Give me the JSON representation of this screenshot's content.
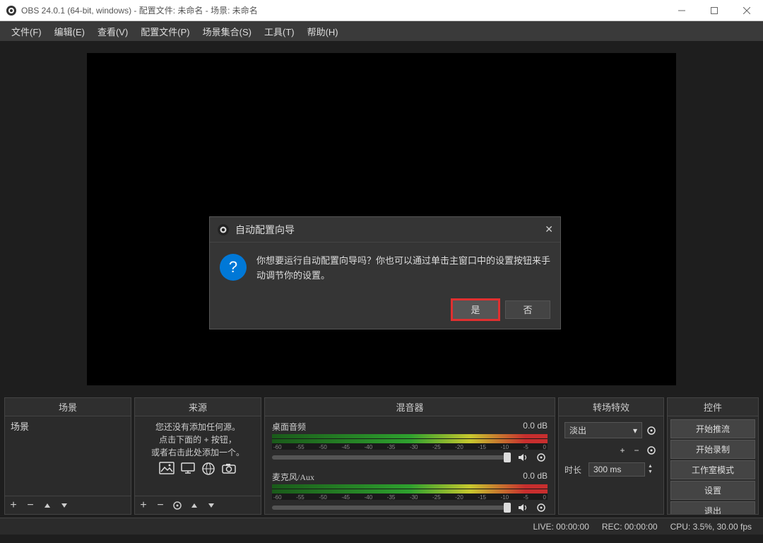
{
  "window": {
    "title": "OBS 24.0.1 (64-bit, windows) - 配置文件: 未命名 - 场景: 未命名"
  },
  "menubar": {
    "file": "文件(F)",
    "edit": "编辑(E)",
    "view": "查看(V)",
    "profile": "配置文件(P)",
    "scenecollection": "场景集合(S)",
    "tools": "工具(T)",
    "help": "帮助(H)"
  },
  "panels": {
    "scenes": {
      "title": "场景",
      "items": [
        "场景"
      ]
    },
    "sources": {
      "title": "来源",
      "empty_line1": "您还没有添加任何源。",
      "empty_line2": "点击下面的 + 按钮，",
      "empty_line3": "或者右击此处添加一个。"
    },
    "mixer": {
      "title": "混音器",
      "channels": [
        {
          "name": "桌面音频",
          "level": "0.0 dB"
        },
        {
          "name": "麦克风/Aux",
          "level": "0.0 dB"
        }
      ],
      "ticks": [
        "-60",
        "-55",
        "-50",
        "-45",
        "-40",
        "-35",
        "-30",
        "-25",
        "-20",
        "-15",
        "-10",
        "-5",
        "0"
      ]
    },
    "transitions": {
      "title": "转场特效",
      "selected": "淡出",
      "duration_label": "时长",
      "duration_value": "300 ms"
    },
    "controls": {
      "title": "控件",
      "buttons": [
        "开始推流",
        "开始录制",
        "工作室模式",
        "设置",
        "退出"
      ]
    }
  },
  "statusbar": {
    "live": "LIVE: 00:00:00",
    "rec": "REC: 00:00:00",
    "cpu": "CPU: 3.5%, 30.00 fps"
  },
  "dialog": {
    "title": "自动配置向导",
    "message": "你想要运行自动配置向导吗？你也可以通过单击主窗口中的设置按钮来手动调节你的设置。",
    "yes": "是",
    "no": "否"
  }
}
